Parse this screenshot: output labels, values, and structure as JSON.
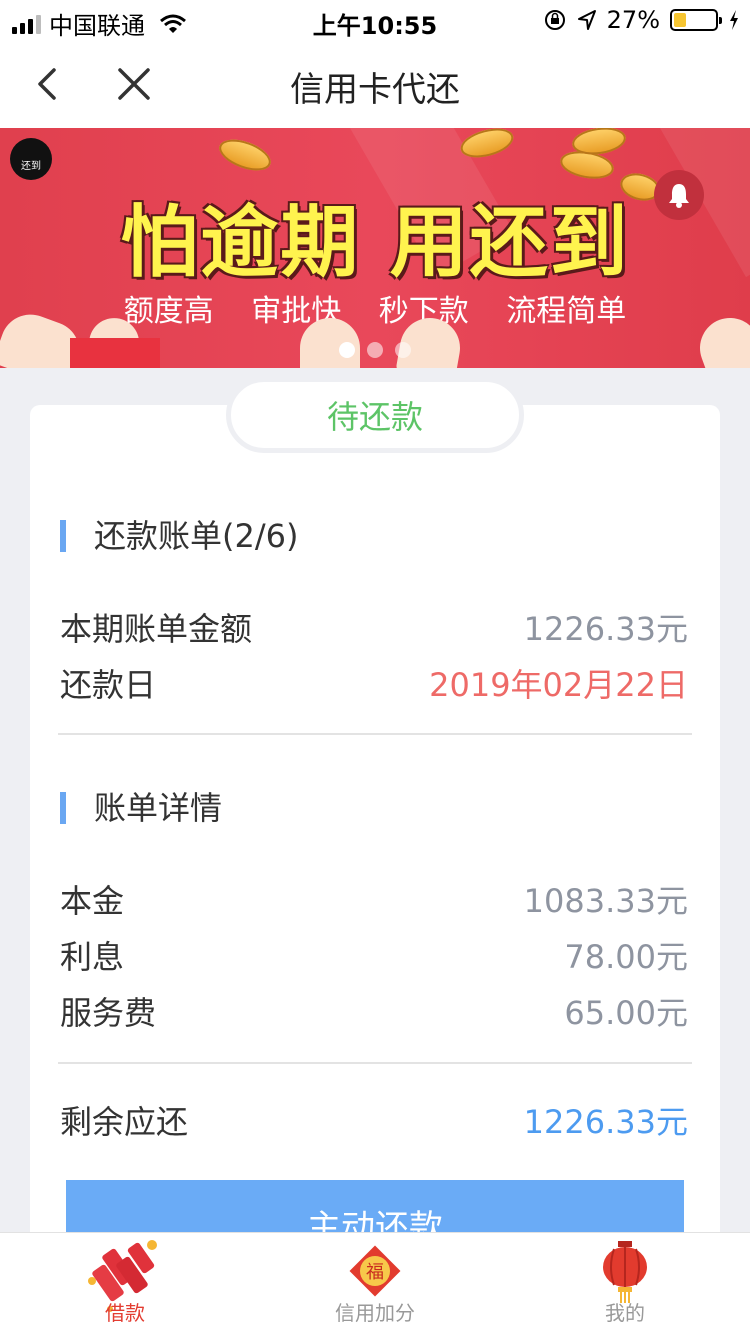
{
  "status_bar": {
    "carrier": "中国联通",
    "time": "上午10:55",
    "battery_percent": "27%"
  },
  "nav": {
    "title": "信用卡代还"
  },
  "banner": {
    "logo_text": "还到",
    "headline": "怕逾期 用还到",
    "tags": "额度高 审批快 秒下款 流程简单",
    "slide_count": 3,
    "active_slide": 1
  },
  "status_pill": "待还款",
  "bill": {
    "title": "还款账单(2/6)",
    "amount_label": "本期账单金额",
    "amount_value": "1226.33元",
    "due_label": "还款日",
    "due_value": "2019年02月22日"
  },
  "details": {
    "title": "账单详情",
    "principal_label": "本金",
    "principal_value": "1083.33元",
    "interest_label": "利息",
    "interest_value": "78.00元",
    "fee_label": "服务费",
    "fee_value": "65.00元"
  },
  "remaining": {
    "label": "剩余应还",
    "value": "1226.33元"
  },
  "pay_button": "主动还款",
  "tabs": [
    {
      "label": "借款",
      "active": true,
      "icon": "firecracker-icon"
    },
    {
      "label": "信用加分",
      "active": false,
      "icon": "fu-icon"
    },
    {
      "label": "我的",
      "active": false,
      "icon": "lantern-icon"
    }
  ],
  "colors": {
    "accent_blue": "#4d9bf0",
    "due_red": "#ee6a67",
    "pill_green": "#5dc467",
    "banner_red": "#e0404e"
  }
}
